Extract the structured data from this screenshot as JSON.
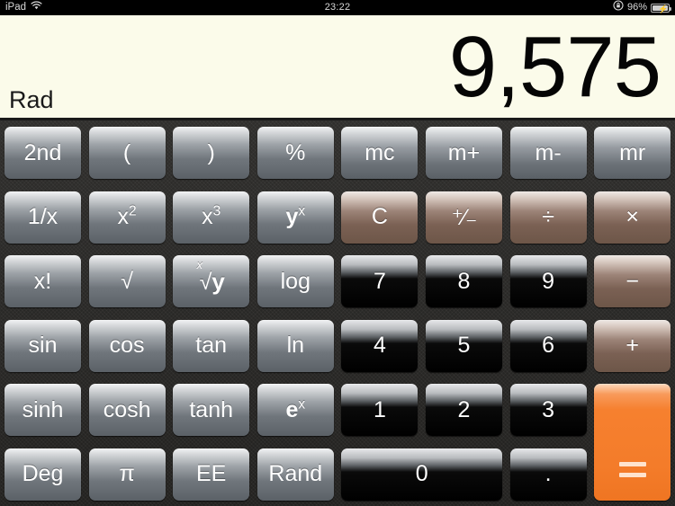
{
  "status_bar": {
    "device": "iPad",
    "wifi_icon": "wifi-icon",
    "time": "23:22",
    "rotation_lock_icon": "rotation-lock-icon",
    "battery_percent": "96%",
    "battery_icon": "battery-charging-icon"
  },
  "display": {
    "value": "9,575",
    "angle_mode": "Rad"
  },
  "colors": {
    "display_bg": "#fbfbea",
    "keypad_bg": "#2b2a28",
    "equals_orange": "#f6802f",
    "operator_brown": "#7b6154",
    "number_black": "#000000",
    "function_gray": "#70767c"
  },
  "keys": [
    {
      "id": "2nd",
      "label": "2nd",
      "type": "fn",
      "col": 0,
      "row": 0
    },
    {
      "id": "lparen",
      "label": "(",
      "type": "fn",
      "col": 1,
      "row": 0
    },
    {
      "id": "rparen",
      "label": ")",
      "type": "fn",
      "col": 2,
      "row": 0
    },
    {
      "id": "pct",
      "label": "%",
      "type": "fn",
      "col": 3,
      "row": 0
    },
    {
      "id": "mc",
      "label": "mc",
      "type": "mem",
      "col": 4,
      "row": 0
    },
    {
      "id": "mplus",
      "label": "m+",
      "type": "mem",
      "col": 5,
      "row": 0
    },
    {
      "id": "mminus",
      "label": "m-",
      "type": "mem",
      "col": 6,
      "row": 0
    },
    {
      "id": "mr",
      "label": "mr",
      "type": "mem",
      "col": 7,
      "row": 0
    },
    {
      "id": "recip",
      "label": "1/x",
      "type": "fn",
      "col": 0,
      "row": 1
    },
    {
      "id": "x2",
      "label": "x²",
      "type": "fn",
      "col": 1,
      "row": 1
    },
    {
      "id": "x3",
      "label": "x³",
      "type": "fn",
      "col": 2,
      "row": 1
    },
    {
      "id": "yx",
      "label": "yˣ",
      "type": "fn",
      "col": 3,
      "row": 1
    },
    {
      "id": "clear",
      "label": "C",
      "type": "op",
      "col": 4,
      "row": 1
    },
    {
      "id": "plusminus",
      "label": "+/-",
      "type": "op",
      "col": 5,
      "row": 1
    },
    {
      "id": "divide",
      "label": "÷",
      "type": "op",
      "col": 6,
      "row": 1
    },
    {
      "id": "multiply",
      "label": "×",
      "type": "op",
      "col": 7,
      "row": 1
    },
    {
      "id": "fact",
      "label": "x!",
      "type": "fn",
      "col": 0,
      "row": 2
    },
    {
      "id": "sqrt",
      "label": "√",
      "type": "fn",
      "col": 1,
      "row": 2
    },
    {
      "id": "xroot",
      "label": "ˣ√y",
      "type": "fn",
      "col": 2,
      "row": 2
    },
    {
      "id": "log",
      "label": "log",
      "type": "fn",
      "col": 3,
      "row": 2
    },
    {
      "id": "7",
      "label": "7",
      "type": "num",
      "col": 4,
      "row": 2
    },
    {
      "id": "8",
      "label": "8",
      "type": "num",
      "col": 5,
      "row": 2
    },
    {
      "id": "9",
      "label": "9",
      "type": "num",
      "col": 6,
      "row": 2
    },
    {
      "id": "minus",
      "label": "−",
      "type": "op",
      "col": 7,
      "row": 2
    },
    {
      "id": "sin",
      "label": "sin",
      "type": "fn",
      "col": 0,
      "row": 3
    },
    {
      "id": "cos",
      "label": "cos",
      "type": "fn",
      "col": 1,
      "row": 3
    },
    {
      "id": "tan",
      "label": "tan",
      "type": "fn",
      "col": 2,
      "row": 3
    },
    {
      "id": "ln",
      "label": "ln",
      "type": "fn",
      "col": 3,
      "row": 3
    },
    {
      "id": "4",
      "label": "4",
      "type": "num",
      "col": 4,
      "row": 3
    },
    {
      "id": "5",
      "label": "5",
      "type": "num",
      "col": 5,
      "row": 3
    },
    {
      "id": "6",
      "label": "6",
      "type": "num",
      "col": 6,
      "row": 3
    },
    {
      "id": "plus",
      "label": "+",
      "type": "op",
      "col": 7,
      "row": 3
    },
    {
      "id": "sinh",
      "label": "sinh",
      "type": "fn",
      "col": 0,
      "row": 4
    },
    {
      "id": "cosh",
      "label": "cosh",
      "type": "fn",
      "col": 1,
      "row": 4
    },
    {
      "id": "tanh",
      "label": "tanh",
      "type": "fn",
      "col": 2,
      "row": 4
    },
    {
      "id": "ex",
      "label": "eˣ",
      "type": "fn",
      "col": 3,
      "row": 4
    },
    {
      "id": "1",
      "label": "1",
      "type": "num",
      "col": 4,
      "row": 4
    },
    {
      "id": "2",
      "label": "2",
      "type": "num",
      "col": 5,
      "row": 4
    },
    {
      "id": "3",
      "label": "3",
      "type": "num",
      "col": 6,
      "row": 4
    },
    {
      "id": "equals",
      "label": "=",
      "type": "eq",
      "col": 7,
      "row": 4
    },
    {
      "id": "deg",
      "label": "Deg",
      "type": "fn",
      "col": 0,
      "row": 5
    },
    {
      "id": "pi",
      "label": "π",
      "type": "fn",
      "col": 1,
      "row": 5
    },
    {
      "id": "ee",
      "label": "EE",
      "type": "fn",
      "col": 2,
      "row": 5
    },
    {
      "id": "rand",
      "label": "Rand",
      "type": "fn",
      "col": 3,
      "row": 5
    },
    {
      "id": "0",
      "label": "0",
      "type": "num",
      "col": 4,
      "row": 5
    },
    {
      "id": "dot",
      "label": ".",
      "type": "num",
      "col": 6,
      "row": 5
    }
  ]
}
